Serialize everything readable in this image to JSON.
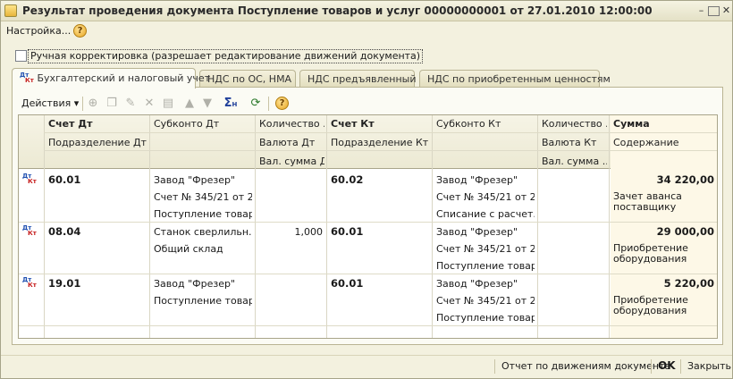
{
  "window": {
    "title": "Результат проведения документа Поступление товаров и услуг 00000000001 от 27.01.2010 12:00:00"
  },
  "menu": {
    "settings_label": "Настройка..."
  },
  "manual_correction": {
    "label": "Ручная корректировка (разрешает редактирование движений документа)",
    "checked": false
  },
  "tabs": [
    {
      "label": "Бухгалтерский и налоговый учет",
      "active": true
    },
    {
      "label": "НДС по ОС, НМА",
      "active": false
    },
    {
      "label": "НДС предъявленный",
      "active": false
    },
    {
      "label": "НДС по приобретенным ценностям",
      "active": false
    }
  ],
  "toolbar": {
    "actions_label": "Действия",
    "sigma_label": "Σ",
    "sigma_sub": "H"
  },
  "row_icon": {
    "dt": "Дт",
    "kt": "Кт"
  },
  "grid": {
    "headers": {
      "row1": [
        "Счет Дт",
        "Субконто Дт",
        "Количество ...",
        "Счет Кт",
        "Субконто Кт",
        "Количество ...",
        "Сумма"
      ],
      "row2": [
        "Подразделение Дт",
        "",
        "Валюта Дт",
        "Подразделение Кт",
        "",
        "Валюта Кт",
        "Содержание"
      ],
      "row3": [
        "",
        "",
        "Вал. сумма Дт",
        "",
        "",
        "Вал. сумма ...",
        ""
      ]
    },
    "rows": [
      {
        "account_dt": "60.01",
        "subconto_dt": [
          "Завод \"Фрезер\"",
          "Счет № 345/21 от 2...",
          "Поступление товар..."
        ],
        "qty_dt": "",
        "account_kt": "60.02",
        "subconto_kt": [
          "Завод \"Фрезер\"",
          "Счет № 345/21 от 2...",
          "Списание с расчет..."
        ],
        "qty_kt": "",
        "amount": "34 220,00",
        "content": "Зачет аванса поставщику"
      },
      {
        "account_dt": "08.04",
        "subconto_dt": [
          "Станок сверлильн...",
          "Общий склад",
          ""
        ],
        "qty_dt": "1,000",
        "account_kt": "60.01",
        "subconto_kt": [
          "Завод \"Фрезер\"",
          "Счет № 345/21 от 2...",
          "Поступление товар..."
        ],
        "qty_kt": "",
        "amount": "29 000,00",
        "content": "Приобретение оборудования по"
      },
      {
        "account_dt": "19.01",
        "subconto_dt": [
          "Завод \"Фрезер\"",
          "Поступление товар...",
          ""
        ],
        "qty_dt": "",
        "account_kt": "60.01",
        "subconto_kt": [
          "Завод \"Фрезер\"",
          "Счет № 345/21 от 2...",
          "Поступление товар..."
        ],
        "qty_kt": "",
        "amount": "5 220,00",
        "content": "Приобретение оборудования по"
      }
    ]
  },
  "footer": {
    "report_label": "Отчет по движениям документа",
    "ok_label": "OK",
    "close_label": "Закрыть"
  }
}
